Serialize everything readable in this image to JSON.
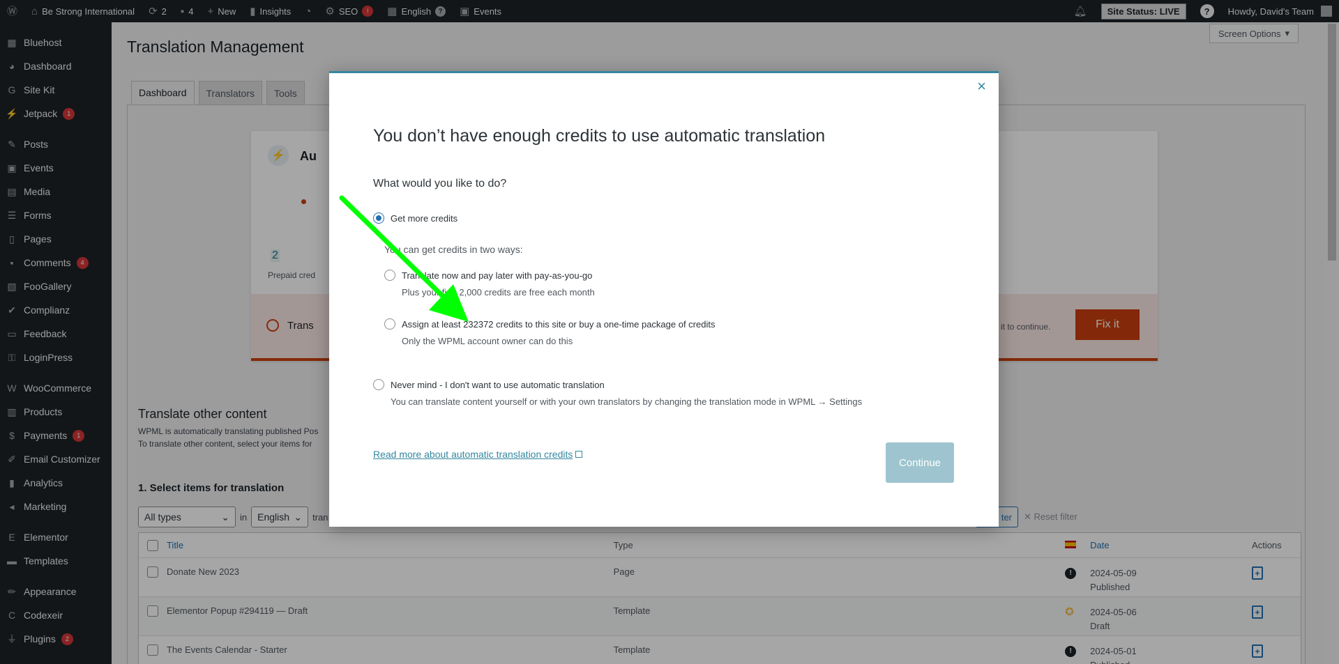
{
  "adminbar": {
    "site_name": "Be Strong International",
    "updates_count": "2",
    "comments_count": "4",
    "new_label": "New",
    "insights_label": "Insights",
    "seo_label": "SEO",
    "seo_badge": "!",
    "language_label": "English",
    "events_label": "Events",
    "site_status": "Site Status: LIVE",
    "howdy": "Howdy, David's Team"
  },
  "sidebar": {
    "items": [
      {
        "label": "Bluehost",
        "icon": "grid-icon"
      },
      {
        "label": "Dashboard",
        "icon": "dashboard-icon"
      },
      {
        "label": "Site Kit",
        "icon": "sitekit-icon"
      },
      {
        "label": "Jetpack",
        "icon": "jetpack-icon",
        "count": "1"
      },
      {
        "label": "Posts",
        "icon": "pin-icon"
      },
      {
        "label": "Events",
        "icon": "calendar-icon"
      },
      {
        "label": "Media",
        "icon": "media-icon"
      },
      {
        "label": "Forms",
        "icon": "forms-icon"
      },
      {
        "label": "Pages",
        "icon": "pages-icon"
      },
      {
        "label": "Comments",
        "icon": "comment-icon",
        "count": "4"
      },
      {
        "label": "FooGallery",
        "icon": "gallery-icon"
      },
      {
        "label": "Complianz",
        "icon": "check-icon"
      },
      {
        "label": "Feedback",
        "icon": "feedback-icon"
      },
      {
        "label": "LoginPress",
        "icon": "key-icon"
      },
      {
        "label": "WooCommerce",
        "icon": "woo-icon"
      },
      {
        "label": "Products",
        "icon": "archive-icon"
      },
      {
        "label": "Payments",
        "icon": "dollar-icon",
        "count": "1"
      },
      {
        "label": "Email Customizer",
        "icon": "brush-icon"
      },
      {
        "label": "Analytics",
        "icon": "chart-bar-icon"
      },
      {
        "label": "Marketing",
        "icon": "megaphone-icon"
      },
      {
        "label": "Elementor",
        "icon": "elementor-icon"
      },
      {
        "label": "Templates",
        "icon": "folder-icon"
      },
      {
        "label": "Appearance",
        "icon": "paintbrush-icon"
      },
      {
        "label": "Codexeir",
        "icon": "code-icon"
      },
      {
        "label": "Plugins",
        "icon": "plugin-icon",
        "count": "2"
      }
    ]
  },
  "page": {
    "title": "Translation Management",
    "screen_options": "Screen Options",
    "tabs": [
      "Dashboard",
      "Translators",
      "Tools"
    ]
  },
  "auto_card": {
    "title": "Au",
    "credits_number": "2",
    "credits_label": "Prepaid cred",
    "alert_text": "Trans",
    "alert_tail": "ion. Fix it to continue.",
    "fix_button": "Fix it"
  },
  "other_content": {
    "title": "Translate other content",
    "desc1": "WPML is automatically translating published Pos",
    "desc2": "To translate other content, select your items for",
    "select_title": "1. Select items for translation",
    "type_filter": "All types",
    "in_label": "in",
    "language_filter": "English",
    "tran_label": "tran",
    "filter_tail": "ter",
    "reset_filter": "Reset filter"
  },
  "table": {
    "headers": {
      "title": "Title",
      "type": "Type",
      "date": "Date",
      "actions": "Actions"
    },
    "rows": [
      {
        "title": "Donate New 2023",
        "type": "Page",
        "date": "2024-05-09",
        "status": "Published",
        "status_icon": "info-dark-icon"
      },
      {
        "title": "Elementor Popup #294119 — Draft",
        "type": "Template",
        "date": "2024-05-06",
        "status": "Draft",
        "status_icon": "translator-orange-icon"
      },
      {
        "title": "The Events Calendar - Starter",
        "type": "Template",
        "date": "2024-05-01",
        "status": "Published",
        "status_icon": "info-dark-icon"
      }
    ]
  },
  "modal": {
    "title": "You don’t have enough credits to use automatic translation",
    "question": "What would you like to do?",
    "option_get_credits": "Get more credits",
    "hint": "You can get credits in two ways:",
    "option_payg": "Translate now and pay later with pay-as-you-go",
    "option_payg_sub": "Plus your first 2,000 credits are free each month",
    "option_assign": "Assign at least 232372 credits to this site or buy a one-time package of credits",
    "option_assign_sub": "Only the WPML account owner can do this",
    "option_nevermind": "Never mind - I don't want to use automatic translation",
    "option_nevermind_sub": "You can translate content yourself or with your own translators by changing the translation mode in WPML → Settings",
    "read_more_link": "Read more about automatic translation credits",
    "continue_button": "Continue",
    "close_symbol": "×"
  },
  "colors": {
    "accent": "#33879e",
    "arrow": "#00ff00",
    "fix_button": "#c9400f",
    "admin_dark": "#1d2327"
  }
}
